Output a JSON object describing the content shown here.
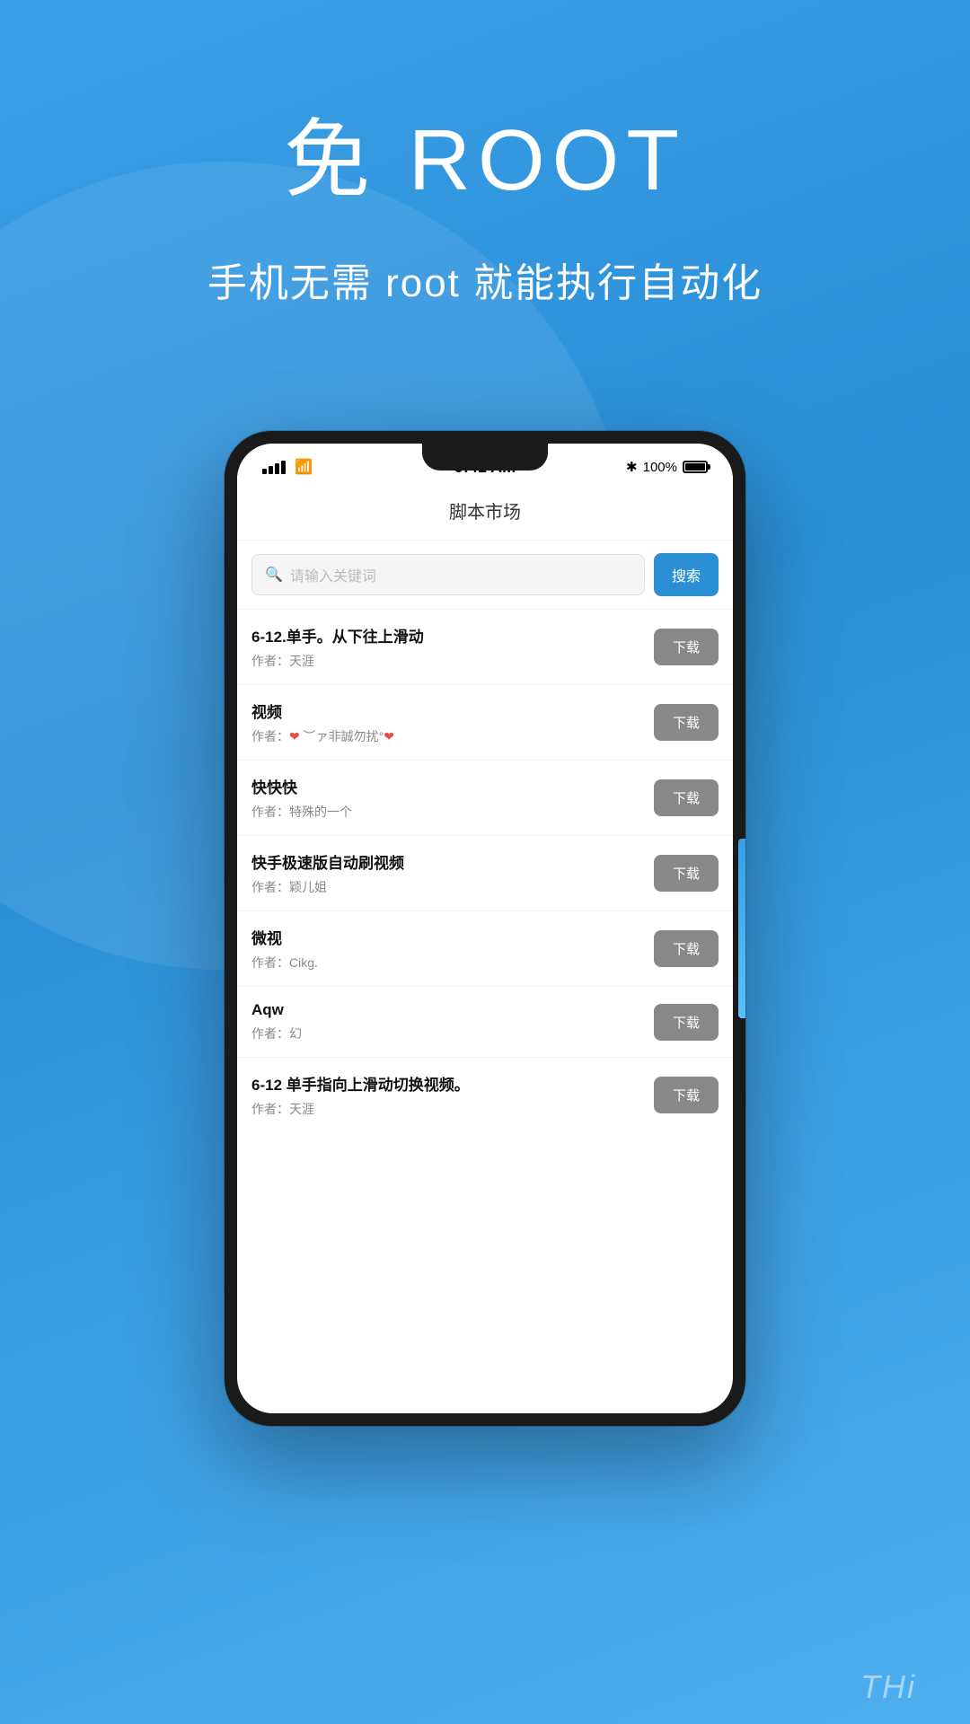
{
  "background": {
    "gradient_start": "#3a9ee8",
    "gradient_end": "#2b8fd6"
  },
  "hero": {
    "title": "免 ROOT",
    "subtitle": "手机无需 root 就能执行自动化"
  },
  "phone": {
    "status_bar": {
      "time": "9:41 AM",
      "battery_percent": "100%",
      "bluetooth": "✱"
    },
    "app_title": "脚本市场",
    "search": {
      "placeholder": "请输入关键词",
      "button_label": "搜索"
    },
    "scripts": [
      {
        "name": "6-12.单手。从下往上滑动",
        "author": "作者：天涯",
        "download_label": "下载"
      },
      {
        "name": "视频",
        "author_prefix": "作者：",
        "author_special": "❤ ︶ァ非誠勿扰°❤",
        "download_label": "下载"
      },
      {
        "name": "快快快",
        "author": "作者：特殊的一个",
        "download_label": "下载"
      },
      {
        "name": "快手极速版自动刷视频",
        "author": "作者：颖儿姐",
        "download_label": "下载"
      },
      {
        "name": "微视",
        "author": "作者：Cikg.",
        "download_label": "下载"
      },
      {
        "name": "Aqw",
        "author": "作者：幻",
        "download_label": "下载"
      },
      {
        "name": "6-12 单手指向上滑动切换视频。",
        "author": "作者：天涯",
        "download_label": "下载"
      }
    ]
  },
  "watermark": {
    "text": "THi"
  }
}
